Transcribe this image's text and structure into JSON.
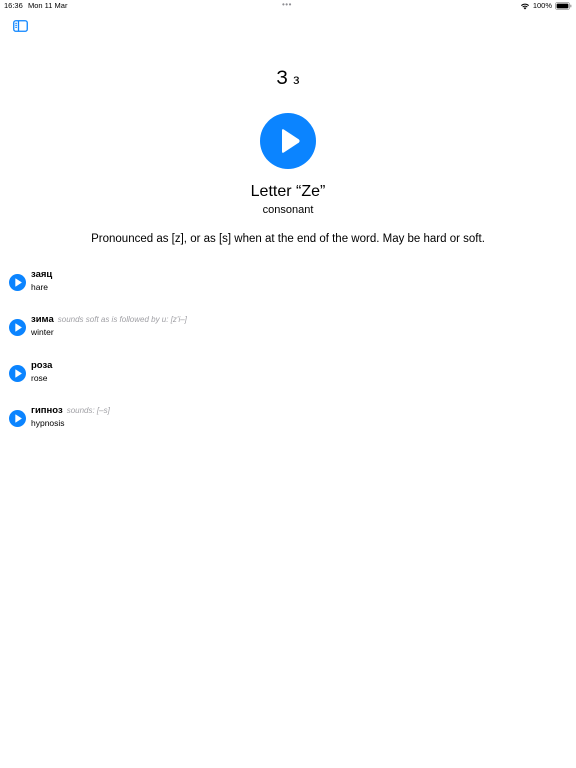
{
  "status_bar": {
    "time": "16:36",
    "date": "Mon 11 Mar",
    "dots": "•••",
    "battery": "100%"
  },
  "letter": {
    "upper": "З",
    "lower": "з",
    "name": "Letter “Ze”",
    "type": "consonant",
    "description": "Pronounced as [z], or as [s] when at the end of the word. May be hard or soft."
  },
  "words": [
    {
      "ru": "заяц",
      "note": "",
      "en": "hare"
    },
    {
      "ru": "зима",
      "note": "sounds soft as is followed by и: [z'i–]",
      "en": "winter"
    },
    {
      "ru": "роза",
      "note": "",
      "en": "rose"
    },
    {
      "ru": "гипноз",
      "note": "sounds: [–s]",
      "en": "hypnosis"
    }
  ],
  "colors": {
    "accent": "#0b84ff",
    "note": "#a0a0a5"
  },
  "icons": {
    "sidebar": "sidebar-toggle-icon",
    "play": "play-icon",
    "wifi": "wifi-icon",
    "battery": "battery-icon"
  }
}
